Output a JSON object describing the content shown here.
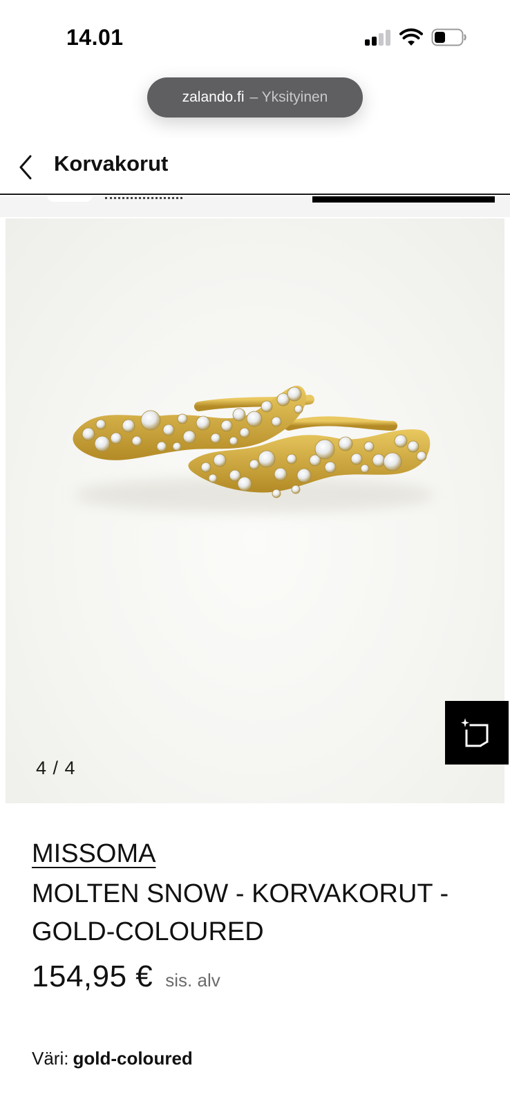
{
  "status_bar": {
    "time": "14.01",
    "icons": [
      "signal-icon",
      "wifi-icon",
      "battery-icon"
    ]
  },
  "browser": {
    "domain": "zalando.fi",
    "mode": "– Yksityinen"
  },
  "header": {
    "back_icon": "chevron-left-icon",
    "title": "Korvakorut"
  },
  "gallery": {
    "counter": "4 / 4",
    "action_icon": "sparkle-crop-icon"
  },
  "product": {
    "brand": "MISSOMA",
    "name": "MOLTEN SNOW - KORVAKORUT - GOLD-COLOURED",
    "price": "154,95 €",
    "vat_note": "sis. alv",
    "color_label": "Väri:",
    "color_value": "gold-coloured"
  },
  "colors": {
    "accent": "#000000",
    "text": "#111111",
    "muted": "#6b6b6b",
    "gold": "#d4ac3a"
  }
}
